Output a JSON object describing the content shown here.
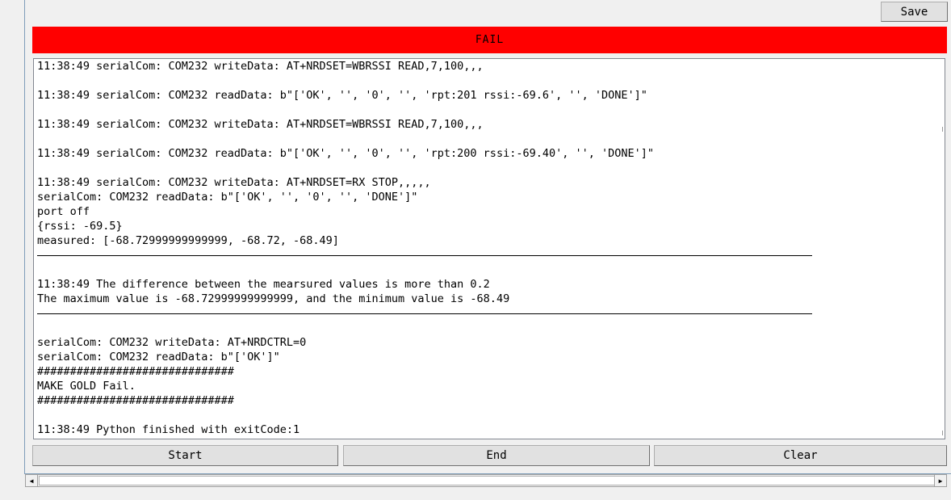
{
  "toolbar": {
    "save_label": "Save"
  },
  "status": {
    "text": "FAIL",
    "color": "#ff0000"
  },
  "log": {
    "lines": [
      {
        "kind": "text",
        "text": "11:38:49 serialCom: COM232 writeData: AT+NRDSET=WBRSSI READ,7,100,,,"
      },
      {
        "kind": "text",
        "text": ""
      },
      {
        "kind": "text",
        "text": "11:38:49 serialCom: COM232 readData: b\"['OK', '', '0', '', 'rpt:201 rssi:-69.6', '', 'DONE']\""
      },
      {
        "kind": "text",
        "text": ""
      },
      {
        "kind": "text",
        "text": "11:38:49 serialCom: COM232 writeData: AT+NRDSET=WBRSSI READ,7,100,,,"
      },
      {
        "kind": "text",
        "text": ""
      },
      {
        "kind": "text",
        "text": "11:38:49 serialCom: COM232 readData: b\"['OK', '', '0', '', 'rpt:200 rssi:-69.40', '', 'DONE']\""
      },
      {
        "kind": "text",
        "text": ""
      },
      {
        "kind": "text",
        "text": "11:38:49 serialCom: COM232 writeData: AT+NRDSET=RX STOP,,,,,"
      },
      {
        "kind": "text",
        "text": "serialCom: COM232 readData: b\"['OK', '', '0', '', 'DONE']\""
      },
      {
        "kind": "text",
        "text": "port off"
      },
      {
        "kind": "text",
        "text": "{rssi: -69.5}"
      },
      {
        "kind": "text",
        "text": "measured: [-68.72999999999999, -68.72, -68.49]"
      },
      {
        "kind": "separator"
      },
      {
        "kind": "text",
        "text": ""
      },
      {
        "kind": "text",
        "text": "11:38:49 The difference between the mearsured values is more than 0.2"
      },
      {
        "kind": "text",
        "text": "The maximum value is -68.72999999999999, and the minimum value is -68.49"
      },
      {
        "kind": "separator"
      },
      {
        "kind": "text",
        "text": ""
      },
      {
        "kind": "text",
        "text": "serialCom: COM232 writeData: AT+NRDCTRL=0"
      },
      {
        "kind": "text",
        "text": "serialCom: COM232 readData: b\"['OK']\""
      },
      {
        "kind": "text",
        "text": "##############################"
      },
      {
        "kind": "text",
        "text": "MAKE GOLD Fail."
      },
      {
        "kind": "text",
        "text": "##############################"
      },
      {
        "kind": "text",
        "text": ""
      },
      {
        "kind": "text",
        "text": "11:38:49 Python finished with exitCode:1"
      }
    ]
  },
  "controls": {
    "start_label": "Start",
    "end_label": "End",
    "clear_label": "Clear"
  },
  "scrollbar": {
    "left_icon": "arrow-left-icon",
    "right_icon": "arrow-right-icon"
  }
}
